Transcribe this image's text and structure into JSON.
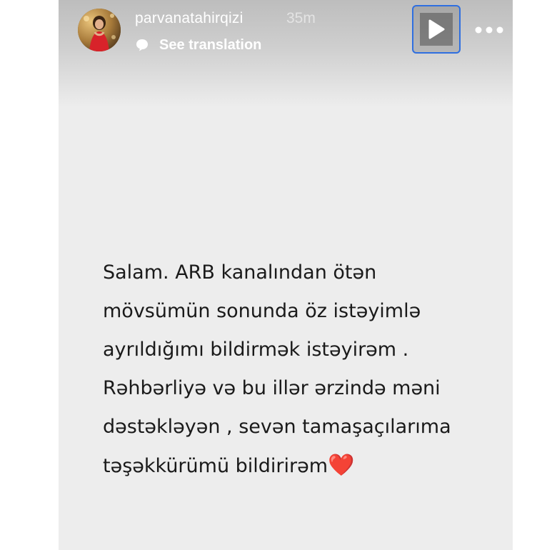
{
  "story": {
    "username": "parvanatahirqizi",
    "time_ago": "35m",
    "translation_label": "See translation",
    "message_lines": [
      "Salam. ARB kanalından ötən",
      "mövsümün sonunda öz istəyimlə",
      "ayrıldığımı bildirmək istəyirəm .",
      "Rəhbərliyə və bu illər ərzində məni",
      "dəstəkləyən , sevən tamaşaçılarıma",
      "təşəkkürümü bildirirəm"
    ],
    "message_emoji": "❤️"
  },
  "icons": {
    "play": "play-icon",
    "more": "more-options-icon",
    "translate": "translate-bubble-icon"
  },
  "colors": {
    "background": "#ededed",
    "text": "#1a1a1a",
    "play_button_border": "#2f6fe0",
    "heart": "#e0262f"
  }
}
